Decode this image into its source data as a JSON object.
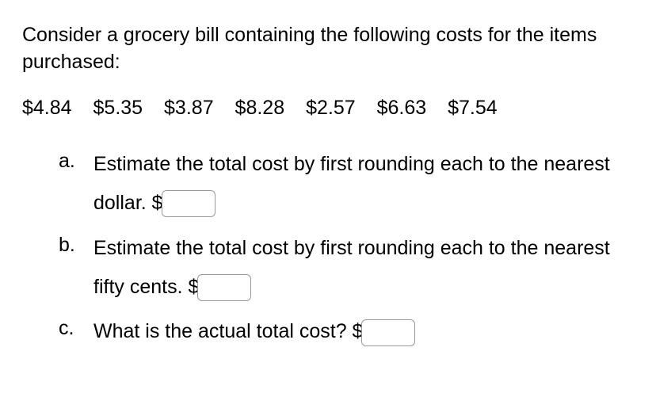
{
  "intro": "Consider a grocery bill containing the following costs for the items purchased:",
  "prices": [
    "$4.84",
    "$5.35",
    "$3.87",
    "$8.28",
    "$2.57",
    "$6.63",
    "$7.54"
  ],
  "questions": {
    "a": {
      "label": "a.",
      "text_before": "Estimate the total cost by first rounding each to the nearest dollar.  $",
      "value": ""
    },
    "b": {
      "label": "b.",
      "text_before": "Estimate the total cost by first rounding each to the nearest fifty cents.  $",
      "value": ""
    },
    "c": {
      "label": "c.",
      "text_before": "What is the actual total cost?  $",
      "value": ""
    }
  }
}
